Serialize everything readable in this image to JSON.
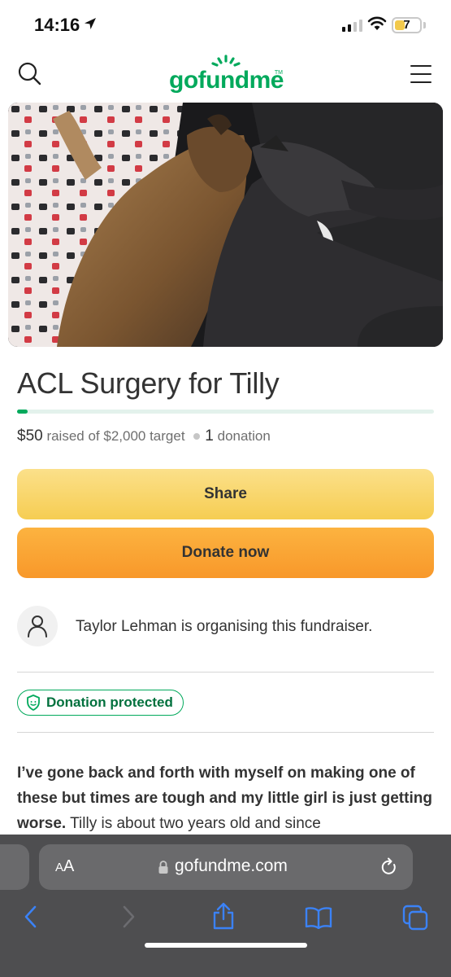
{
  "status_bar": {
    "time": "14:16",
    "battery": "7"
  },
  "header": {
    "logo": "gofundme",
    "logo_tm": "TM"
  },
  "campaign": {
    "title": "ACL Surgery for Tilly",
    "progress_fraction": 0.025,
    "raised_amount": "$50",
    "raised_suffix": "raised of $2,000 target",
    "donation_count": "1",
    "donation_label": "donation"
  },
  "buttons": {
    "share": "Share",
    "donate": "Donate now"
  },
  "organiser": {
    "text": "Taylor Lehman is organising this fundraiser."
  },
  "badge": {
    "label": "Donation protected"
  },
  "story": {
    "bold": "I’ve gone back and forth with myself on making one of these but times are tough and my little girl is just getting worse.",
    "rest": " Tilly is about two years old and since"
  },
  "browser": {
    "aa_small": "A",
    "aa_large": "A",
    "domain": "gofundme.com"
  },
  "colors": {
    "brand_green": "#02a95c",
    "share_yellow": "#f6cd52",
    "donate_orange": "#f8982a",
    "safari_bar": "#4e4e50"
  },
  "icons": [
    "location-arrow-icon",
    "signal-icon",
    "wifi-icon",
    "battery-icon",
    "search-icon",
    "menu-icon",
    "user-icon",
    "shield-icon",
    "lock-icon",
    "reload-icon",
    "back-icon",
    "forward-icon",
    "share-icon",
    "bookmarks-icon",
    "tabs-icon"
  ]
}
